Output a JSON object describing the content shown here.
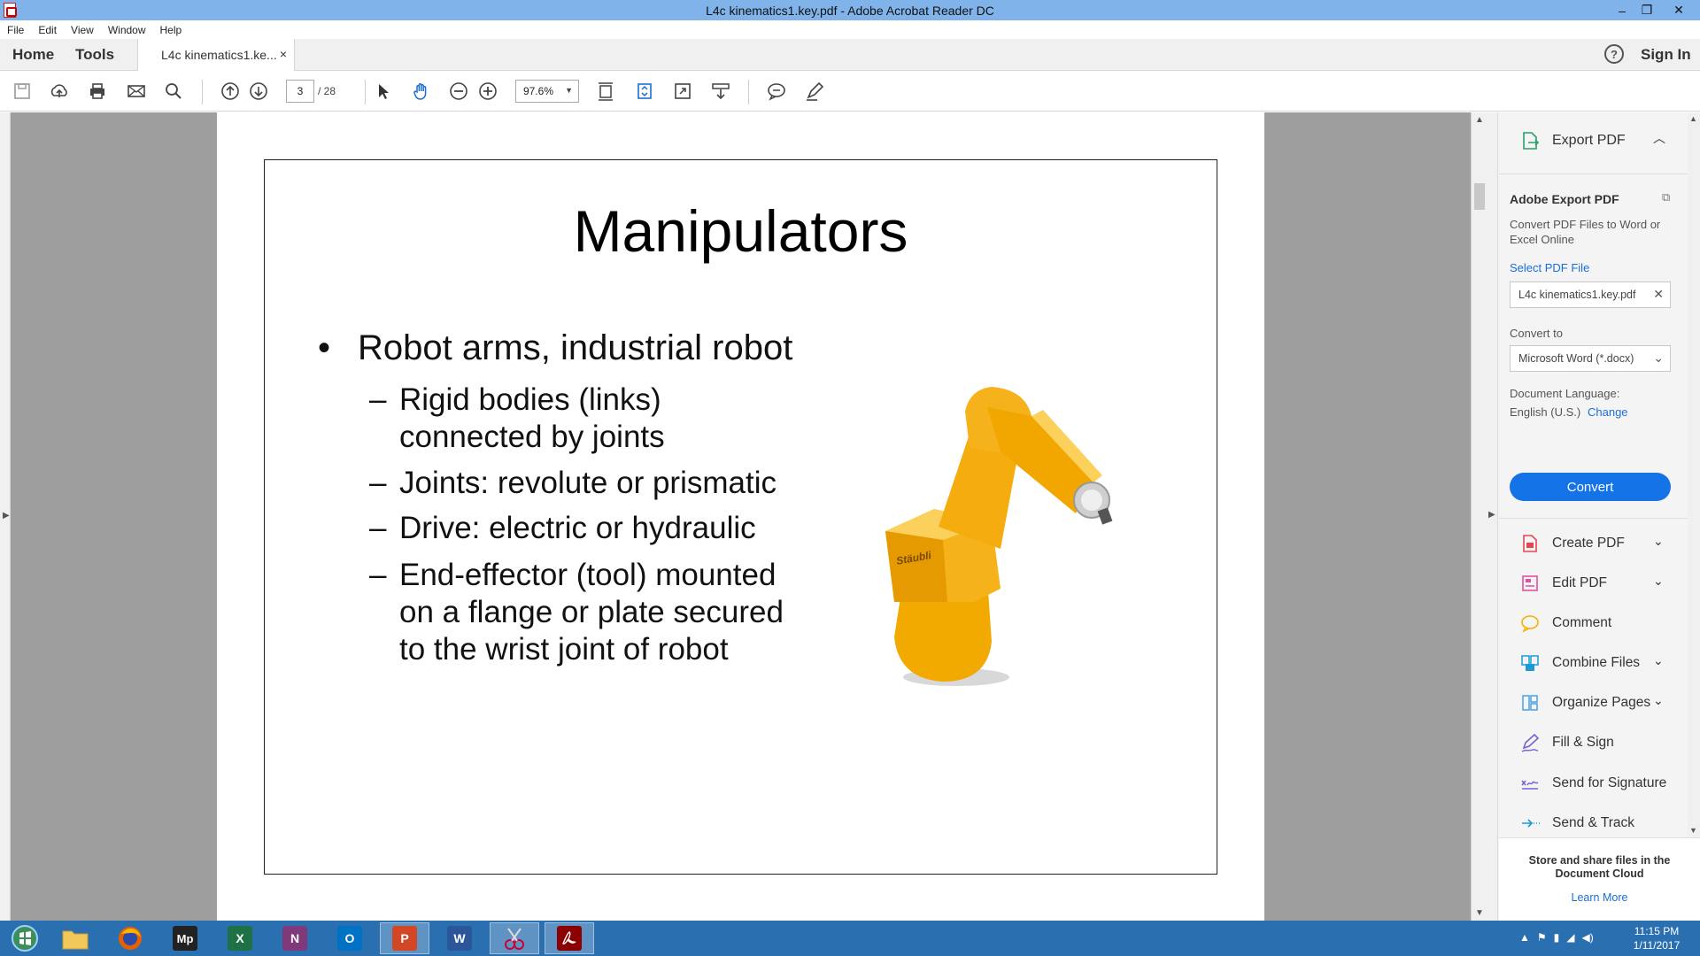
{
  "window": {
    "title": "L4c kinematics1.key.pdf - Adobe Acrobat Reader DC",
    "minimize": "–",
    "restore": "❐",
    "close": "✕"
  },
  "menu": [
    "File",
    "Edit",
    "View",
    "Window",
    "Help"
  ],
  "tabs": {
    "home": "Home",
    "tools": "Tools",
    "document": "L4c kinematics1.ke...",
    "close": "×",
    "help": "?",
    "sign_in": "Sign In"
  },
  "toolbar": {
    "page_current": "3",
    "page_total": "/ 28",
    "zoom": "97.6%"
  },
  "slide": {
    "title": "Manipulators",
    "bullet": "Robot arms, industrial robot",
    "bullet_marker": "•",
    "sub_marker": "–",
    "sub_bullets": [
      [
        "Rigid bodies (links)",
        "connected by joints"
      ],
      [
        "Joints: revolute or prismatic"
      ],
      [
        "Drive: electric or hydraulic"
      ],
      [
        "End-effector (tool) mounted",
        "on a flange or plate secured",
        "to the wrist joint of robot"
      ]
    ],
    "robot_brand": "Stäubli"
  },
  "panel": {
    "header": "Export PDF",
    "card_title": "Adobe Export PDF",
    "card_desc": "Convert PDF Files to Word or Excel Online",
    "select_label": "Select PDF File",
    "selected_file": "L4c kinematics1.key.pdf",
    "convert_to_label": "Convert to",
    "convert_to_value": "Microsoft Word (*.docx)",
    "doc_lang_label": "Document Language:",
    "doc_lang_value": "English (U.S.)",
    "change_link": "Change",
    "convert_button": "Convert",
    "tools": [
      {
        "label": "Create PDF",
        "icon": "create-pdf-icon",
        "expandable": true
      },
      {
        "label": "Edit PDF",
        "icon": "edit-pdf-icon",
        "expandable": true
      },
      {
        "label": "Comment",
        "icon": "comment-icon",
        "expandable": false
      },
      {
        "label": "Combine Files",
        "icon": "combine-files-icon",
        "expandable": true
      },
      {
        "label": "Organize Pages",
        "icon": "organize-pages-icon",
        "expandable": true
      },
      {
        "label": "Fill & Sign",
        "icon": "fill-sign-icon",
        "expandable": false
      },
      {
        "label": "Send for Signature",
        "icon": "send-signature-icon",
        "expandable": false
      },
      {
        "label": "Send & Track",
        "icon": "send-track-icon",
        "expandable": false
      }
    ],
    "cloud_text": "Store and share files in the Document Cloud",
    "learn_more": "Learn More"
  },
  "taskbar": {
    "apps": [
      "Start",
      "File Explorer",
      "Firefox",
      "Maple",
      "Excel",
      "OneNote",
      "Outlook",
      "PowerPoint",
      "Word",
      "Snipping Tool",
      "Acrobat Reader"
    ],
    "time": "11:15 PM",
    "date": "1/11/2017"
  }
}
